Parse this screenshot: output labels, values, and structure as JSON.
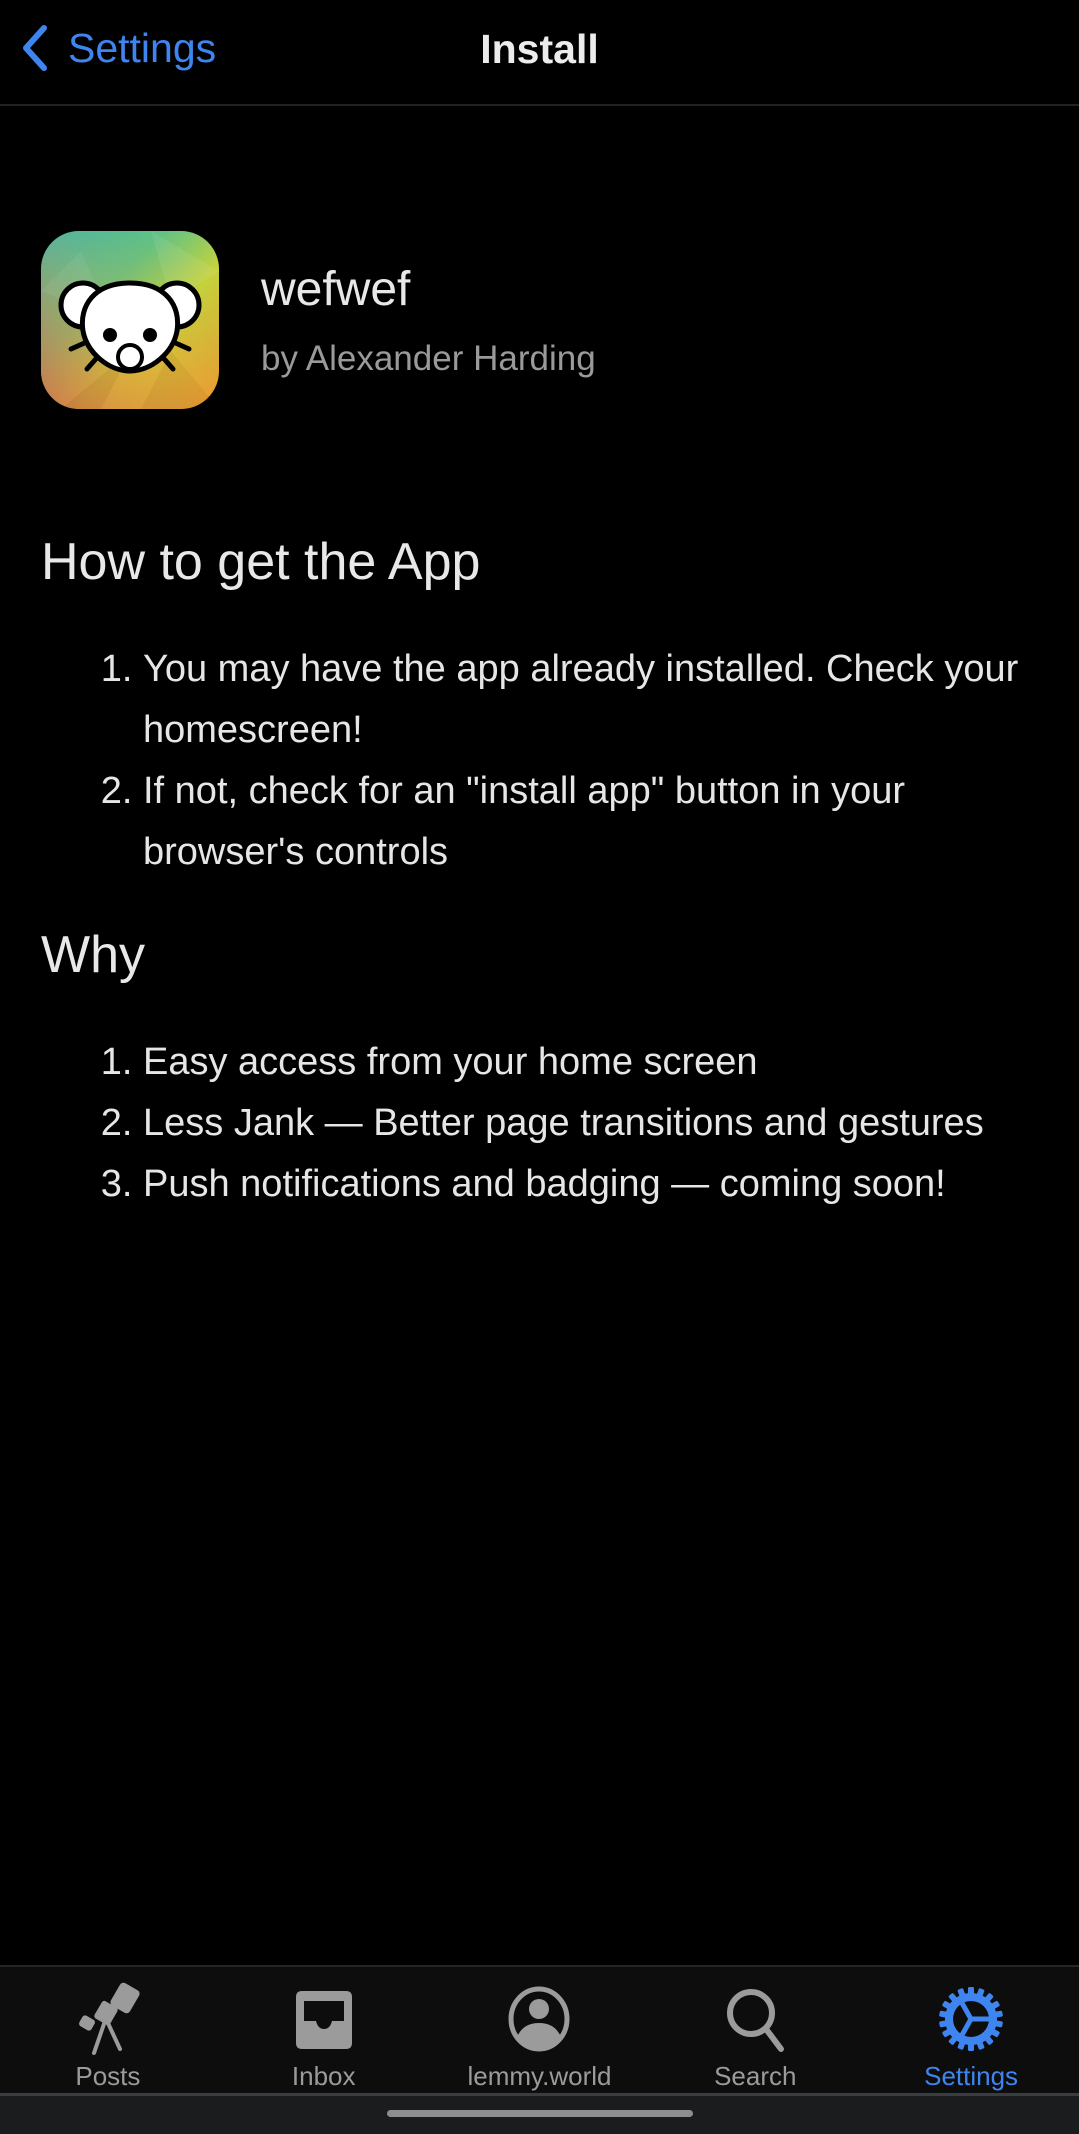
{
  "header": {
    "back_label": "Settings",
    "title": "Install"
  },
  "app": {
    "name": "wefwef",
    "author": "by Alexander Harding"
  },
  "sections": [
    {
      "heading": "How to get the App",
      "items": [
        "You may have the app already installed. Check your homescreen!",
        "If not, check for an \"install app\" button in your browser's controls"
      ]
    },
    {
      "heading": "Why",
      "items": [
        "Easy access from your home screen",
        "Less Jank — Better page transitions and gestures",
        "Push notifications and badging — coming soon!"
      ]
    }
  ],
  "tabbar": {
    "tabs": [
      {
        "label": "Posts",
        "icon": "telescope-icon",
        "active": false
      },
      {
        "label": "Inbox",
        "icon": "inbox-tray-icon",
        "active": false
      },
      {
        "label": "lemmy.world",
        "icon": "person-circle-icon",
        "active": false
      },
      {
        "label": "Search",
        "icon": "search-icon",
        "active": false
      },
      {
        "label": "Settings",
        "icon": "gear-icon",
        "active": true
      }
    ]
  },
  "colors": {
    "accent": "#3f85f0",
    "inactive": "#9b9b9b",
    "background": "#000000"
  }
}
